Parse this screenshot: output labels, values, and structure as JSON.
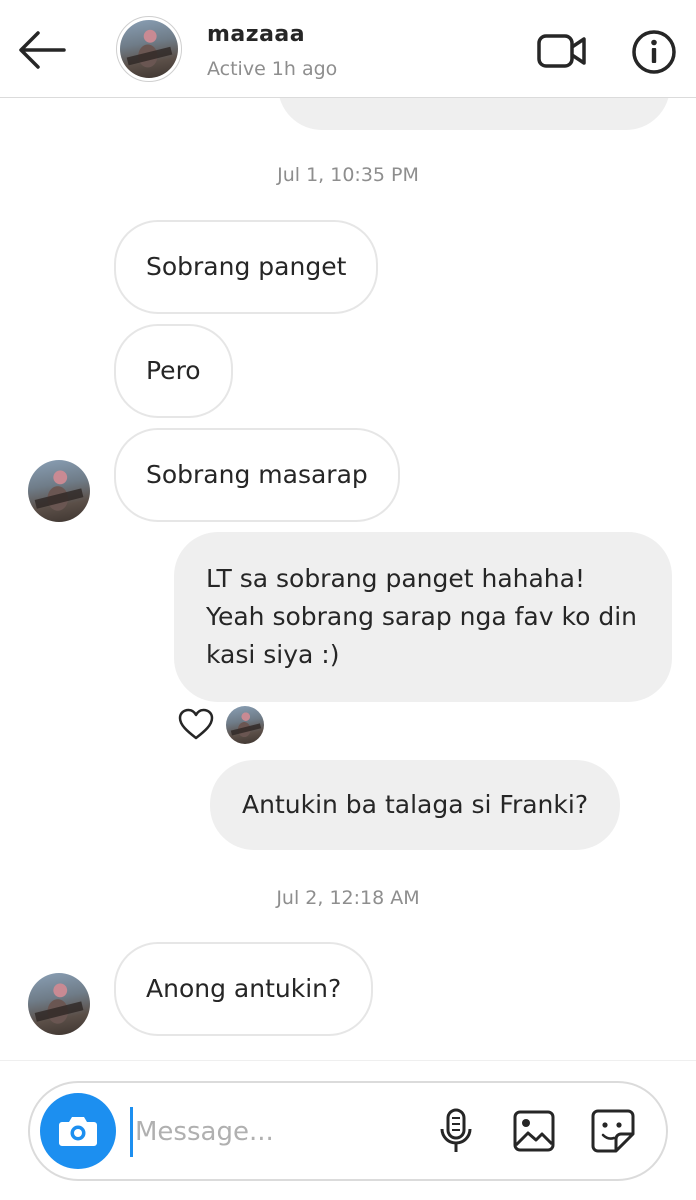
{
  "header": {
    "username": "mazaaa",
    "status": "Active 1h ago"
  },
  "icons": {
    "back": "arrow-left-icon",
    "video": "video-call-icon",
    "info": "info-icon",
    "heart": "heart-icon",
    "camera": "camera-icon",
    "mic": "microphone-icon",
    "gallery": "gallery-icon",
    "sticker": "sticker-icon"
  },
  "colors": {
    "accent": "#1c8ff0",
    "outgoing_bubble": "#efefef",
    "timestamp": "#8e8e8e"
  },
  "conversation": {
    "timestamp_1": "Jul 1, 10:35 PM",
    "timestamp_2": "Jul 2, 12:18 AM",
    "messages": [
      {
        "text": "Sobrang panget",
        "direction": "incoming"
      },
      {
        "text": "Pero",
        "direction": "incoming"
      },
      {
        "text": "Sobrang masarap",
        "direction": "incoming"
      },
      {
        "text": "LT sa sobrang panget hahaha! Yeah sobrang sarap nga fav ko din kasi siya :)",
        "direction": "outgoing"
      },
      {
        "text": "Antukin ba talaga si Franki?",
        "direction": "outgoing"
      },
      {
        "text": "Anong antukin?",
        "direction": "incoming"
      }
    ]
  },
  "composer": {
    "placeholder": "Message..."
  }
}
